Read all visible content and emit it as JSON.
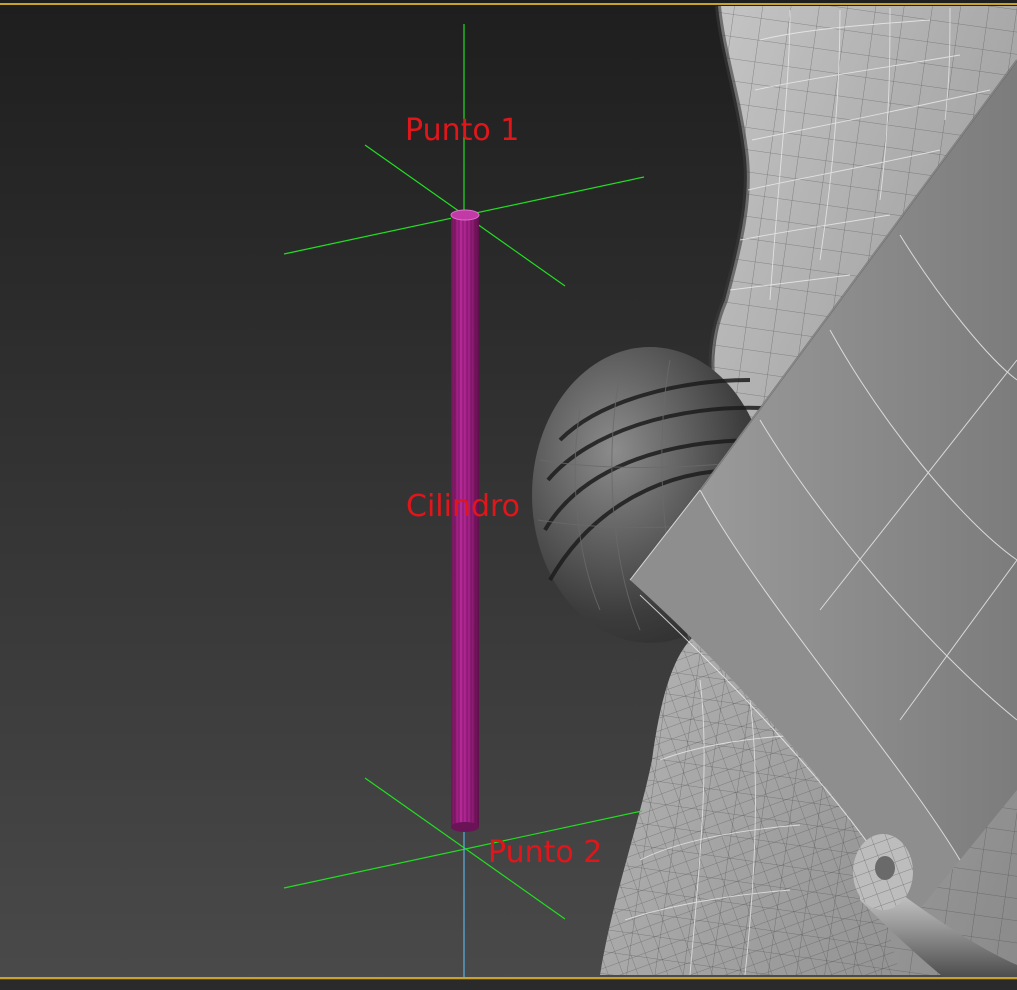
{
  "viewport": {
    "frame_color": "#c9a227",
    "bg_top": "#1f1f1f",
    "bg_bottom": "#4b4b4b"
  },
  "labels": {
    "point_1": "Punto 1",
    "cylinder": "Cilindro",
    "point_2": "Punto 2",
    "color": "#e0161b"
  },
  "objects": {
    "cylinder_color": "#a0207f",
    "helper_axis_color": "#22dd22",
    "vertical_axis_color": "#5ab0e0",
    "mesh_color": "#8d8d8d",
    "wire_color": "#e8e8e8"
  }
}
